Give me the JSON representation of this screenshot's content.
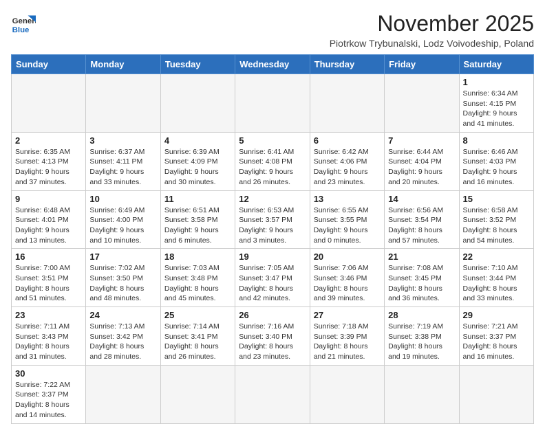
{
  "logo": {
    "line1": "General",
    "line2": "Blue"
  },
  "title": "November 2025",
  "subtitle": "Piotrkow Trybunalski, Lodz Voivodeship, Poland",
  "days_of_week": [
    "Sunday",
    "Monday",
    "Tuesday",
    "Wednesday",
    "Thursday",
    "Friday",
    "Saturday"
  ],
  "weeks": [
    [
      {
        "day": "",
        "info": ""
      },
      {
        "day": "",
        "info": ""
      },
      {
        "day": "",
        "info": ""
      },
      {
        "day": "",
        "info": ""
      },
      {
        "day": "",
        "info": ""
      },
      {
        "day": "",
        "info": ""
      },
      {
        "day": "1",
        "info": "Sunrise: 6:34 AM\nSunset: 4:15 PM\nDaylight: 9 hours\nand 41 minutes."
      }
    ],
    [
      {
        "day": "2",
        "info": "Sunrise: 6:35 AM\nSunset: 4:13 PM\nDaylight: 9 hours\nand 37 minutes."
      },
      {
        "day": "3",
        "info": "Sunrise: 6:37 AM\nSunset: 4:11 PM\nDaylight: 9 hours\nand 33 minutes."
      },
      {
        "day": "4",
        "info": "Sunrise: 6:39 AM\nSunset: 4:09 PM\nDaylight: 9 hours\nand 30 minutes."
      },
      {
        "day": "5",
        "info": "Sunrise: 6:41 AM\nSunset: 4:08 PM\nDaylight: 9 hours\nand 26 minutes."
      },
      {
        "day": "6",
        "info": "Sunrise: 6:42 AM\nSunset: 4:06 PM\nDaylight: 9 hours\nand 23 minutes."
      },
      {
        "day": "7",
        "info": "Sunrise: 6:44 AM\nSunset: 4:04 PM\nDaylight: 9 hours\nand 20 minutes."
      },
      {
        "day": "8",
        "info": "Sunrise: 6:46 AM\nSunset: 4:03 PM\nDaylight: 9 hours\nand 16 minutes."
      }
    ],
    [
      {
        "day": "9",
        "info": "Sunrise: 6:48 AM\nSunset: 4:01 PM\nDaylight: 9 hours\nand 13 minutes."
      },
      {
        "day": "10",
        "info": "Sunrise: 6:49 AM\nSunset: 4:00 PM\nDaylight: 9 hours\nand 10 minutes."
      },
      {
        "day": "11",
        "info": "Sunrise: 6:51 AM\nSunset: 3:58 PM\nDaylight: 9 hours\nand 6 minutes."
      },
      {
        "day": "12",
        "info": "Sunrise: 6:53 AM\nSunset: 3:57 PM\nDaylight: 9 hours\nand 3 minutes."
      },
      {
        "day": "13",
        "info": "Sunrise: 6:55 AM\nSunset: 3:55 PM\nDaylight: 9 hours\nand 0 minutes."
      },
      {
        "day": "14",
        "info": "Sunrise: 6:56 AM\nSunset: 3:54 PM\nDaylight: 8 hours\nand 57 minutes."
      },
      {
        "day": "15",
        "info": "Sunrise: 6:58 AM\nSunset: 3:52 PM\nDaylight: 8 hours\nand 54 minutes."
      }
    ],
    [
      {
        "day": "16",
        "info": "Sunrise: 7:00 AM\nSunset: 3:51 PM\nDaylight: 8 hours\nand 51 minutes."
      },
      {
        "day": "17",
        "info": "Sunrise: 7:02 AM\nSunset: 3:50 PM\nDaylight: 8 hours\nand 48 minutes."
      },
      {
        "day": "18",
        "info": "Sunrise: 7:03 AM\nSunset: 3:48 PM\nDaylight: 8 hours\nand 45 minutes."
      },
      {
        "day": "19",
        "info": "Sunrise: 7:05 AM\nSunset: 3:47 PM\nDaylight: 8 hours\nand 42 minutes."
      },
      {
        "day": "20",
        "info": "Sunrise: 7:06 AM\nSunset: 3:46 PM\nDaylight: 8 hours\nand 39 minutes."
      },
      {
        "day": "21",
        "info": "Sunrise: 7:08 AM\nSunset: 3:45 PM\nDaylight: 8 hours\nand 36 minutes."
      },
      {
        "day": "22",
        "info": "Sunrise: 7:10 AM\nSunset: 3:44 PM\nDaylight: 8 hours\nand 33 minutes."
      }
    ],
    [
      {
        "day": "23",
        "info": "Sunrise: 7:11 AM\nSunset: 3:43 PM\nDaylight: 8 hours\nand 31 minutes."
      },
      {
        "day": "24",
        "info": "Sunrise: 7:13 AM\nSunset: 3:42 PM\nDaylight: 8 hours\nand 28 minutes."
      },
      {
        "day": "25",
        "info": "Sunrise: 7:14 AM\nSunset: 3:41 PM\nDaylight: 8 hours\nand 26 minutes."
      },
      {
        "day": "26",
        "info": "Sunrise: 7:16 AM\nSunset: 3:40 PM\nDaylight: 8 hours\nand 23 minutes."
      },
      {
        "day": "27",
        "info": "Sunrise: 7:18 AM\nSunset: 3:39 PM\nDaylight: 8 hours\nand 21 minutes."
      },
      {
        "day": "28",
        "info": "Sunrise: 7:19 AM\nSunset: 3:38 PM\nDaylight: 8 hours\nand 19 minutes."
      },
      {
        "day": "29",
        "info": "Sunrise: 7:21 AM\nSunset: 3:37 PM\nDaylight: 8 hours\nand 16 minutes."
      }
    ],
    [
      {
        "day": "30",
        "info": "Sunrise: 7:22 AM\nSunset: 3:37 PM\nDaylight: 8 hours\nand 14 minutes."
      },
      {
        "day": "",
        "info": ""
      },
      {
        "day": "",
        "info": ""
      },
      {
        "day": "",
        "info": ""
      },
      {
        "day": "",
        "info": ""
      },
      {
        "day": "",
        "info": ""
      },
      {
        "day": "",
        "info": ""
      }
    ]
  ]
}
